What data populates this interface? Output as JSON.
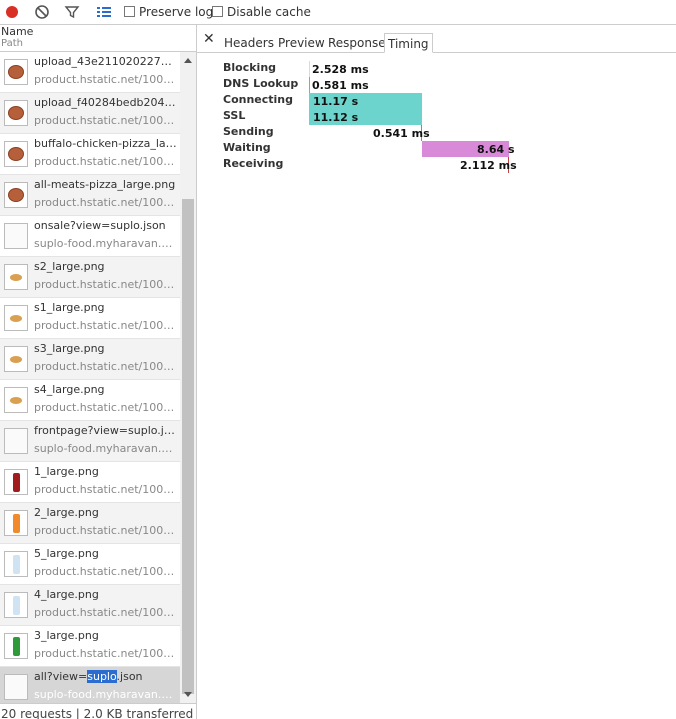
{
  "toolbar": {
    "preserve_log": "Preserve log",
    "disable_cache": "Disable cache"
  },
  "columns": {
    "name": "Name",
    "path": "Path"
  },
  "requests": [
    {
      "name": "upload_43e21102022749f8...",
      "path": "product.hstatic.net/100025...",
      "icon": "pizza"
    },
    {
      "name": "upload_f40284bedb2046b2...",
      "path": "product.hstatic.net/100025...",
      "icon": "pizza"
    },
    {
      "name": "buffalo-chicken-pizza_large...",
      "path": "product.hstatic.net/100025...",
      "icon": "pizza"
    },
    {
      "name": "all-meats-pizza_large.png",
      "path": "product.hstatic.net/100025...",
      "icon": "pizza"
    },
    {
      "name": "onsale?view=suplo.json",
      "path": "suplo-food.myharavan.com...",
      "icon": "blank"
    },
    {
      "name": "s2_large.png",
      "path": "product.hstatic.net/100025...",
      "icon": "snack"
    },
    {
      "name": "s1_large.png",
      "path": "product.hstatic.net/100025...",
      "icon": "snack"
    },
    {
      "name": "s3_large.png",
      "path": "product.hstatic.net/100025...",
      "icon": "snack"
    },
    {
      "name": "s4_large.png",
      "path": "product.hstatic.net/100025...",
      "icon": "snack"
    },
    {
      "name": "frontpage?view=suplo.json",
      "path": "suplo-food.myharavan.com...",
      "icon": "blank"
    },
    {
      "name": "1_large.png",
      "path": "product.hstatic.net/100025...",
      "icon": "bottle-red"
    },
    {
      "name": "2_large.png",
      "path": "product.hstatic.net/100025...",
      "icon": "bottle-orange"
    },
    {
      "name": "5_large.png",
      "path": "product.hstatic.net/100025...",
      "icon": "bottle-clear"
    },
    {
      "name": "4_large.png",
      "path": "product.hstatic.net/100025...",
      "icon": "bottle-clear"
    },
    {
      "name": "3_large.png",
      "path": "product.hstatic.net/100025...",
      "icon": "bottle-green"
    }
  ],
  "selected_request": {
    "name_before": "all?view=",
    "name_highlight": "suplo",
    "name_after": ".json",
    "path": "suplo-food.myharavan.com..."
  },
  "status": "20 requests | 2.0 KB transferred",
  "tabs": [
    "Headers",
    "Preview",
    "Response",
    "Timing"
  ],
  "active_tab": "Timing",
  "timing": [
    {
      "label": "Blocking",
      "value": "2.528 ms",
      "color": "#f0e08a"
    },
    {
      "label": "DNS Lookup",
      "value": "0.581 ms",
      "color": "#5fbfa0"
    },
    {
      "label": "Connecting",
      "value": "11.17 s",
      "color": "#6cd4cc"
    },
    {
      "label": "SSL",
      "value": "11.12 s",
      "color": "#6cd4cc"
    },
    {
      "label": "Sending",
      "value": "0.541 ms",
      "color": "#888888"
    },
    {
      "label": "Waiting",
      "value": "8.64 s",
      "color": "#d88ad8"
    },
    {
      "label": "Receiving",
      "value": "2.112 ms",
      "color": "#c04040"
    }
  ]
}
